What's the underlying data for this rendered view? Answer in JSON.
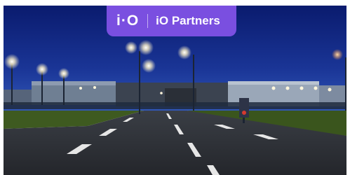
{
  "badge": {
    "logo_text": "i·O",
    "brand_name": "iO Partners"
  },
  "colors": {
    "badge_background": "#7a4fe0",
    "sky_top": "#0b1f78",
    "sky_horizon": "#2447a6",
    "road": "#2b2e33",
    "grass": "#3d5a1e",
    "lights": "#fff6dc"
  }
}
